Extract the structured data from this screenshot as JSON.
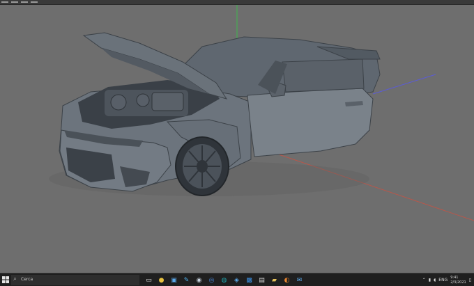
{
  "viewport": {
    "background": "#6e6e6e",
    "axes": {
      "x_color": "#b8574b",
      "y_color": "#3fb84c",
      "z_color": "#5b5bd6"
    },
    "model": "car with open hood and open driver door"
  },
  "taskbar": {
    "search": {
      "label": "Cerca",
      "icon": "search-icon"
    },
    "icons": [
      "start-icon",
      "task-view-icon",
      "chrome-icon",
      "file-explorer-icon",
      "paint-icon",
      "steam-icon",
      "cinema4d-icon",
      "edge-icon",
      "store-icon",
      "photoshop-icon",
      "notepad-icon",
      "folder-icon",
      "blender-icon",
      "mail-icon"
    ],
    "tray": {
      "lang": "ENG",
      "time": "9:41",
      "date": "2/3/2021"
    }
  }
}
